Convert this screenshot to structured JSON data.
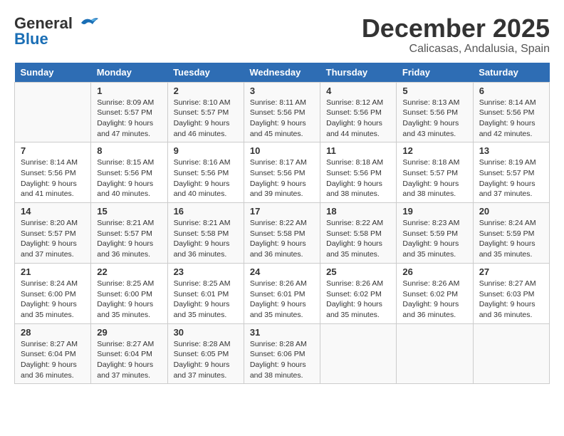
{
  "logo": {
    "general": "General",
    "blue": "Blue"
  },
  "title": "December 2025",
  "location": "Calicasas, Andalusia, Spain",
  "days_of_week": [
    "Sunday",
    "Monday",
    "Tuesday",
    "Wednesday",
    "Thursday",
    "Friday",
    "Saturday"
  ],
  "weeks": [
    [
      {
        "day": "",
        "info": ""
      },
      {
        "day": "1",
        "info": "Sunrise: 8:09 AM\nSunset: 5:57 PM\nDaylight: 9 hours\nand 47 minutes."
      },
      {
        "day": "2",
        "info": "Sunrise: 8:10 AM\nSunset: 5:57 PM\nDaylight: 9 hours\nand 46 minutes."
      },
      {
        "day": "3",
        "info": "Sunrise: 8:11 AM\nSunset: 5:56 PM\nDaylight: 9 hours\nand 45 minutes."
      },
      {
        "day": "4",
        "info": "Sunrise: 8:12 AM\nSunset: 5:56 PM\nDaylight: 9 hours\nand 44 minutes."
      },
      {
        "day": "5",
        "info": "Sunrise: 8:13 AM\nSunset: 5:56 PM\nDaylight: 9 hours\nand 43 minutes."
      },
      {
        "day": "6",
        "info": "Sunrise: 8:14 AM\nSunset: 5:56 PM\nDaylight: 9 hours\nand 42 minutes."
      }
    ],
    [
      {
        "day": "7",
        "info": "Sunrise: 8:14 AM\nSunset: 5:56 PM\nDaylight: 9 hours\nand 41 minutes."
      },
      {
        "day": "8",
        "info": "Sunrise: 8:15 AM\nSunset: 5:56 PM\nDaylight: 9 hours\nand 40 minutes."
      },
      {
        "day": "9",
        "info": "Sunrise: 8:16 AM\nSunset: 5:56 PM\nDaylight: 9 hours\nand 40 minutes."
      },
      {
        "day": "10",
        "info": "Sunrise: 8:17 AM\nSunset: 5:56 PM\nDaylight: 9 hours\nand 39 minutes."
      },
      {
        "day": "11",
        "info": "Sunrise: 8:18 AM\nSunset: 5:56 PM\nDaylight: 9 hours\nand 38 minutes."
      },
      {
        "day": "12",
        "info": "Sunrise: 8:18 AM\nSunset: 5:57 PM\nDaylight: 9 hours\nand 38 minutes."
      },
      {
        "day": "13",
        "info": "Sunrise: 8:19 AM\nSunset: 5:57 PM\nDaylight: 9 hours\nand 37 minutes."
      }
    ],
    [
      {
        "day": "14",
        "info": "Sunrise: 8:20 AM\nSunset: 5:57 PM\nDaylight: 9 hours\nand 37 minutes."
      },
      {
        "day": "15",
        "info": "Sunrise: 8:21 AM\nSunset: 5:57 PM\nDaylight: 9 hours\nand 36 minutes."
      },
      {
        "day": "16",
        "info": "Sunrise: 8:21 AM\nSunset: 5:58 PM\nDaylight: 9 hours\nand 36 minutes."
      },
      {
        "day": "17",
        "info": "Sunrise: 8:22 AM\nSunset: 5:58 PM\nDaylight: 9 hours\nand 36 minutes."
      },
      {
        "day": "18",
        "info": "Sunrise: 8:22 AM\nSunset: 5:58 PM\nDaylight: 9 hours\nand 35 minutes."
      },
      {
        "day": "19",
        "info": "Sunrise: 8:23 AM\nSunset: 5:59 PM\nDaylight: 9 hours\nand 35 minutes."
      },
      {
        "day": "20",
        "info": "Sunrise: 8:24 AM\nSunset: 5:59 PM\nDaylight: 9 hours\nand 35 minutes."
      }
    ],
    [
      {
        "day": "21",
        "info": "Sunrise: 8:24 AM\nSunset: 6:00 PM\nDaylight: 9 hours\nand 35 minutes."
      },
      {
        "day": "22",
        "info": "Sunrise: 8:25 AM\nSunset: 6:00 PM\nDaylight: 9 hours\nand 35 minutes."
      },
      {
        "day": "23",
        "info": "Sunrise: 8:25 AM\nSunset: 6:01 PM\nDaylight: 9 hours\nand 35 minutes."
      },
      {
        "day": "24",
        "info": "Sunrise: 8:26 AM\nSunset: 6:01 PM\nDaylight: 9 hours\nand 35 minutes."
      },
      {
        "day": "25",
        "info": "Sunrise: 8:26 AM\nSunset: 6:02 PM\nDaylight: 9 hours\nand 35 minutes."
      },
      {
        "day": "26",
        "info": "Sunrise: 8:26 AM\nSunset: 6:02 PM\nDaylight: 9 hours\nand 36 minutes."
      },
      {
        "day": "27",
        "info": "Sunrise: 8:27 AM\nSunset: 6:03 PM\nDaylight: 9 hours\nand 36 minutes."
      }
    ],
    [
      {
        "day": "28",
        "info": "Sunrise: 8:27 AM\nSunset: 6:04 PM\nDaylight: 9 hours\nand 36 minutes."
      },
      {
        "day": "29",
        "info": "Sunrise: 8:27 AM\nSunset: 6:04 PM\nDaylight: 9 hours\nand 37 minutes."
      },
      {
        "day": "30",
        "info": "Sunrise: 8:28 AM\nSunset: 6:05 PM\nDaylight: 9 hours\nand 37 minutes."
      },
      {
        "day": "31",
        "info": "Sunrise: 8:28 AM\nSunset: 6:06 PM\nDaylight: 9 hours\nand 38 minutes."
      },
      {
        "day": "",
        "info": ""
      },
      {
        "day": "",
        "info": ""
      },
      {
        "day": "",
        "info": ""
      }
    ]
  ]
}
